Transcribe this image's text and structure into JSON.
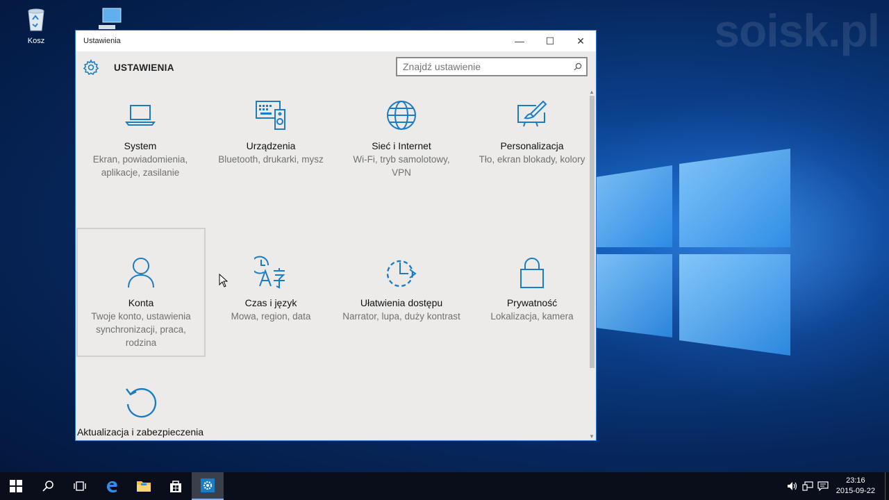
{
  "watermark": "soisk.pl",
  "desktop": {
    "icons": [
      {
        "label": "Kosz",
        "icon": "recycle-bin-icon"
      },
      {
        "label": "",
        "icon": "this-pc-icon"
      }
    ]
  },
  "window": {
    "title": "Ustawienia",
    "controls": {
      "minimize": "—",
      "maximize": "☐",
      "close": "✕"
    },
    "header_title": "USTAWIENIA",
    "search": {
      "placeholder": "Znajdź ustawienie",
      "value": ""
    }
  },
  "tiles": [
    {
      "name": "System",
      "desc": "Ekran, powiadomienia, aplikacje, zasilanie",
      "icon": "laptop-icon"
    },
    {
      "name": "Urządzenia",
      "desc": "Bluetooth, drukarki, mysz",
      "icon": "devices-icon"
    },
    {
      "name": "Sieć i Internet",
      "desc": "Wi-Fi, tryb samolotowy, VPN",
      "icon": "globe-icon"
    },
    {
      "name": "Personalizacja",
      "desc": "Tło, ekran blokady, kolory",
      "icon": "personalization-icon"
    },
    {
      "name": "Konta",
      "desc": "Twoje konto, ustawienia synchronizacji, praca, rodzina",
      "icon": "person-icon"
    },
    {
      "name": "Czas i język",
      "desc": "Mowa, region, data",
      "icon": "time-language-icon"
    },
    {
      "name": "Ułatwienia dostępu",
      "desc": "Narrator, lupa, duży kontrast",
      "icon": "ease-of-access-icon"
    },
    {
      "name": "Prywatność",
      "desc": "Lokalizacja, kamera",
      "icon": "lock-icon"
    },
    {
      "name": "Aktualizacja i zabezpieczenia",
      "desc": "",
      "icon": "update-icon"
    }
  ],
  "taskbar": {
    "clock_time": "23:16",
    "clock_date": "2015-09-22"
  },
  "colors": {
    "accent": "#0078d7",
    "icon_blue": "#1a7cc4"
  }
}
